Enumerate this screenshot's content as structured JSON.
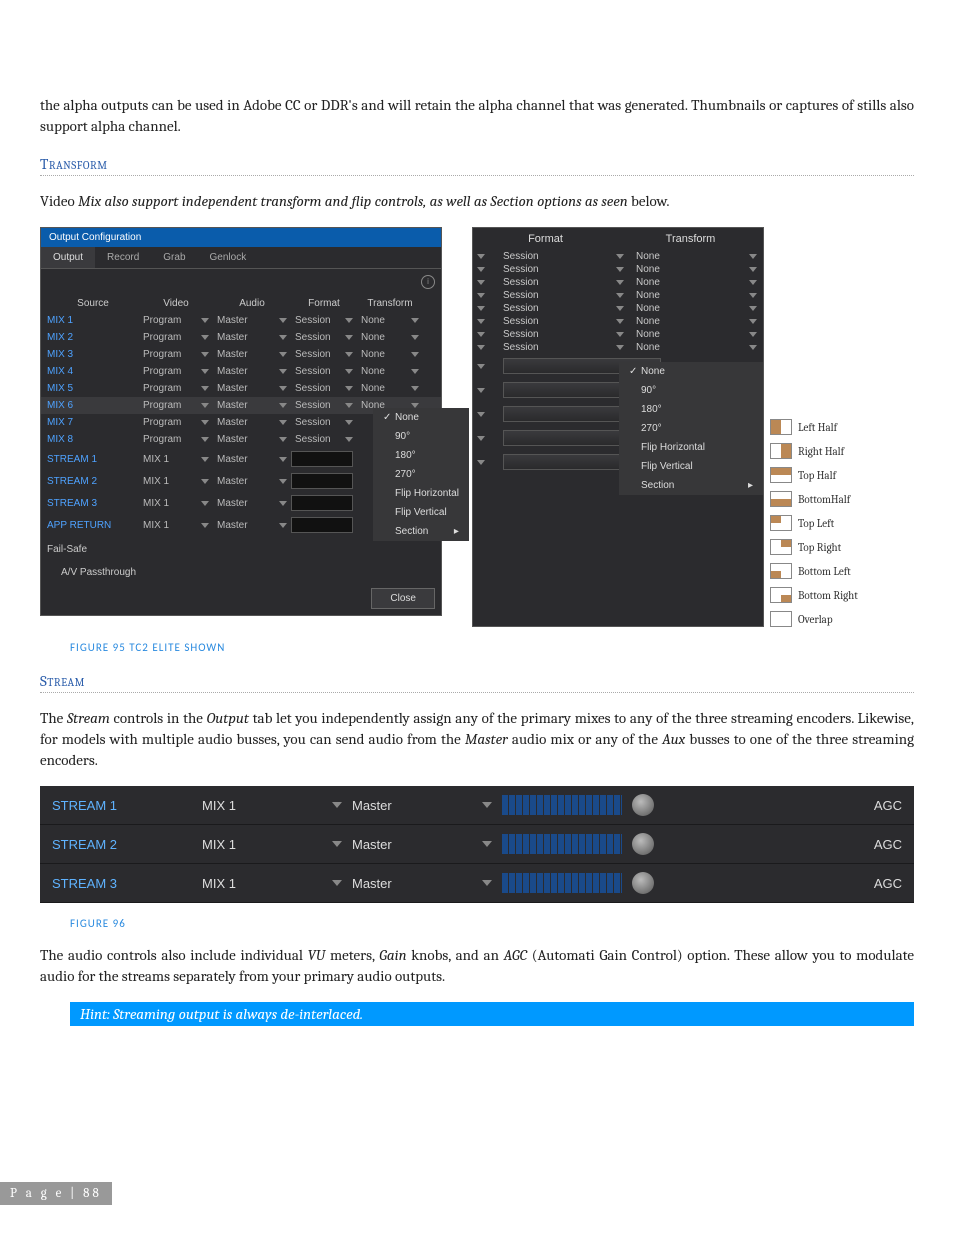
{
  "intro": "the alpha outputs can be used in Adobe CC or DDR's and will retain the alpha channel that was generated. Thumbnails or captures of stills also support alpha channel.",
  "headings": {
    "transform": "Transform",
    "stream": "Stream"
  },
  "transform_sentence_pre": "Video ",
  "transform_sentence_italic": "Mix also support independent transform and flip controls, as well as Section options as seen",
  "transform_sentence_post": " below.",
  "fig95": "FIGURE 95 TC2 ELITE SHOWN",
  "fig96": "FIGURE 96",
  "panel": {
    "title": "Output Configuration",
    "tabs": [
      "Output",
      "Record",
      "Grab",
      "Genlock"
    ],
    "active_tab": 0,
    "cols": {
      "source": "Source",
      "video": "Video",
      "audio": "Audio",
      "format": "Format",
      "transform": "Transform"
    },
    "rows": [
      {
        "src": "MIX 1",
        "video": "Program",
        "audio": "Master",
        "format": "Session",
        "transform": "None"
      },
      {
        "src": "MIX 2",
        "video": "Program",
        "audio": "Master",
        "format": "Session",
        "transform": "None"
      },
      {
        "src": "MIX 3",
        "video": "Program",
        "audio": "Master",
        "format": "Session",
        "transform": "None"
      },
      {
        "src": "MIX 4",
        "video": "Program",
        "audio": "Master",
        "format": "Session",
        "transform": "None"
      },
      {
        "src": "MIX 5",
        "video": "Program",
        "audio": "Master",
        "format": "Session",
        "transform": "None"
      },
      {
        "src": "MIX 6",
        "video": "Program",
        "audio": "Master",
        "format": "Session",
        "transform": "None",
        "highlight": true
      },
      {
        "src": "MIX 7",
        "video": "Program",
        "audio": "Master",
        "format": "Session",
        "transform": "menu"
      },
      {
        "src": "MIX 8",
        "video": "Program",
        "audio": "Master",
        "format": "Session"
      },
      {
        "src": "STREAM 1",
        "video": "MIX 1",
        "audio": "Master"
      },
      {
        "src": "STREAM 2",
        "video": "MIX 1",
        "audio": "Master"
      },
      {
        "src": "STREAM 3",
        "video": "MIX 1",
        "audio": "Master"
      },
      {
        "src": "APP RETURN",
        "video": "MIX 1",
        "audio": "Master"
      }
    ],
    "transform_menu": [
      "None",
      "90°",
      "180°",
      "270°",
      "Flip Horizontal",
      "Flip Vertical",
      "Section"
    ],
    "transform_menu_checked": 0,
    "failsafe": "Fail-Safe",
    "av": "A/V Passthrough",
    "close": "Close"
  },
  "panel2": {
    "headers": [
      "Format",
      "Transform"
    ],
    "rows8": [
      {
        "format": "Session",
        "transform": "None"
      },
      {
        "format": "Session",
        "transform": "None"
      },
      {
        "format": "Session",
        "transform": "None"
      },
      {
        "format": "Session",
        "transform": "None"
      },
      {
        "format": "Session",
        "transform": "None"
      },
      {
        "format": "Session",
        "transform": "None"
      },
      {
        "format": "Session",
        "transform": "None"
      },
      {
        "format": "Session",
        "transform": "None"
      }
    ],
    "menu": [
      "None",
      "90°",
      "180°",
      "270°",
      "Flip Horizontal",
      "Flip Vertical",
      "Section"
    ],
    "menu_checked": 0
  },
  "section_popout": [
    "Left Half",
    "Right Half",
    "Top Half",
    "BottomHalf",
    "Top Left",
    "Top Right",
    "Bottom Left",
    "Bottom Right",
    "Overlap"
  ],
  "stream_para_parts": [
    "The ",
    "Stream",
    " controls in the ",
    "Output",
    " tab let you independently assign any of the primary mixes to any of the three streaming encoders.  Likewise, for models with multiple audio busses, you can send audio from the ",
    "Master",
    " audio mix or any of the ",
    "Aux",
    " busses to one of the three streaming encoders."
  ],
  "stream_rows": [
    {
      "name": "STREAM 1",
      "video": "MIX 1",
      "audio": "Master",
      "agc": "AGC"
    },
    {
      "name": "STREAM 2",
      "video": "MIX 1",
      "audio": "Master",
      "agc": "AGC"
    },
    {
      "name": "STREAM 3",
      "video": "MIX 1",
      "audio": "Master",
      "agc": "AGC"
    }
  ],
  "audio_para_parts": [
    "The audio controls also include individual ",
    "VU",
    " meters, ",
    "Gain",
    " knobs, and an ",
    "AGC",
    " (Automati Gain Control) option. These allow you to modulate audio for the streams separately from your primary audio outputs."
  ],
  "hint": "Hint: Streaming output is always de-interlaced.",
  "footer": "P a g e  | 88"
}
